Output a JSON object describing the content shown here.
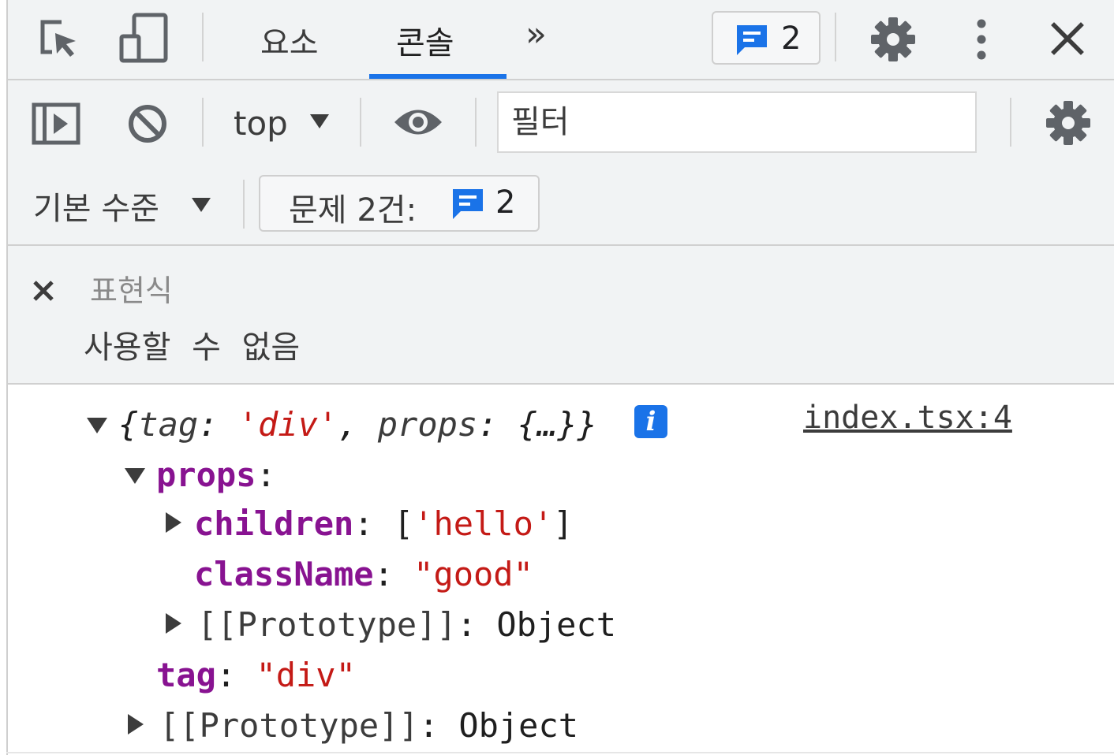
{
  "tabbar": {
    "tabs": [
      {
        "label": "요소",
        "active": false
      },
      {
        "label": "콘솔",
        "active": true
      }
    ],
    "more_tabs_glyph": "»",
    "issues_count": "2",
    "icons": [
      "inspect-element-icon",
      "device-toolbar-icon",
      "issues-message-icon",
      "settings-gear-icon",
      "kebab-menu-icon",
      "close-icon"
    ]
  },
  "toolbar": {
    "context": "top",
    "filter_placeholder": "필터",
    "level": "기본 수준",
    "issues_label": "문제 2건:",
    "issues_count": "2",
    "icons": [
      "sidebar-toggle-icon",
      "clear-console-icon",
      "context-dropdown-icon",
      "live-expression-eye-icon",
      "console-settings-gear-icon"
    ]
  },
  "live_expression": {
    "label": "표현식",
    "value": "사용할 수 없음"
  },
  "console": {
    "source": "index.tsx:4",
    "summary": {
      "open_brace": "{",
      "key1": "tag",
      "colon": ": ",
      "val1": "'div'",
      "comma": ", ",
      "key2": "props",
      "val2": "{…}",
      "close_brace": "}"
    },
    "info_badge": "i",
    "rows": {
      "props_key": "props",
      "children_key": "children",
      "children_value": "'hello'",
      "className_key": "className",
      "className_value": "\"good\"",
      "proto_label": "[[Prototype]]",
      "proto_value": "Object",
      "tag_key": "tag",
      "tag_value": "\"div\""
    }
  },
  "colors": {
    "accent": "#1a73e8",
    "key_purple": "#881391",
    "string_red": "#c41a16",
    "toolbar_bg": "#f1f3f4"
  }
}
